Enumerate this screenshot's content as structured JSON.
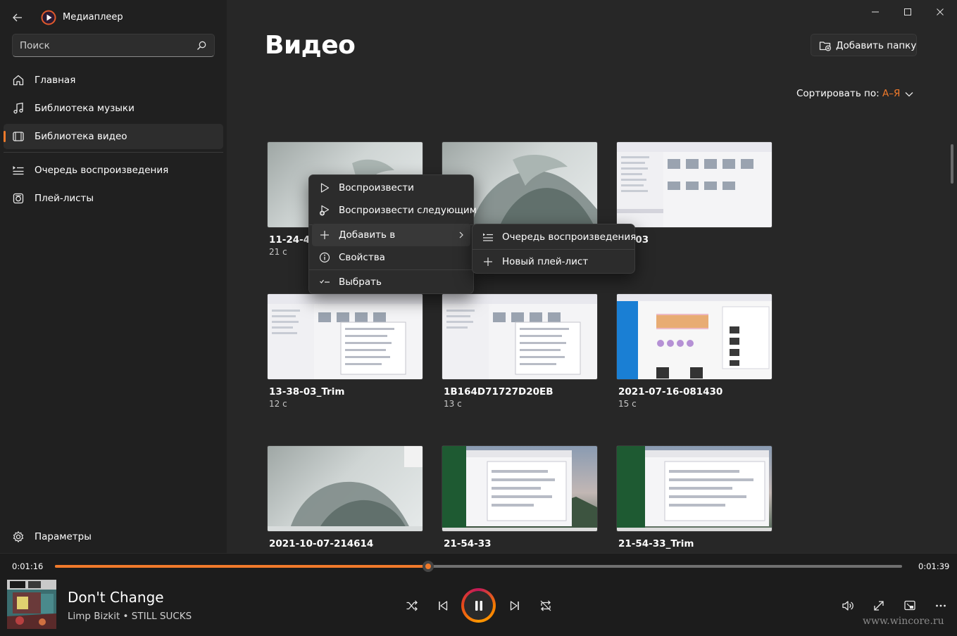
{
  "app": {
    "title": "Медиаплеер"
  },
  "search": {
    "placeholder": "Поиск"
  },
  "nav": {
    "home": "Главная",
    "music": "Библиотека музыки",
    "video": "Библиотека видео",
    "queue": "Очередь воспроизведения",
    "playlists": "Плей-листы",
    "settings": "Параметры"
  },
  "main": {
    "title": "Видео",
    "add_folder": "Добавить папку",
    "sort_label": "Сортировать по: ",
    "sort_value": "А–Я"
  },
  "videos": [
    {
      "title": "11-24-47",
      "duration": "21 с"
    },
    {
      "title": "",
      "duration": ""
    },
    {
      "title": "38-03",
      "duration": ""
    },
    {
      "title": "13-38-03_Trim",
      "duration": "12 с"
    },
    {
      "title": "1B164D71727D20EB",
      "duration": "13 с"
    },
    {
      "title": "2021-07-16-081430",
      "duration": "15 с"
    },
    {
      "title": "2021-10-07-214614",
      "duration": ""
    },
    {
      "title": "21-54-33",
      "duration": ""
    },
    {
      "title": "21-54-33_Trim",
      "duration": ""
    }
  ],
  "context_menu": {
    "play": "Воспроизвести",
    "play_next": "Воспроизвести следующим",
    "add_to": "Добавить в",
    "properties": "Свойства",
    "select": "Выбрать"
  },
  "submenu": {
    "queue": "Очередь воспроизведения",
    "new_playlist": "Новый плей-лист"
  },
  "player": {
    "elapsed": "0:01:16",
    "total": "0:01:39",
    "progress_fraction": 0.4405,
    "song": "Don't Change",
    "artist_album": "Limp Bizkit • STILL SUCKS"
  },
  "watermark": "www.wincore.ru",
  "colors": {
    "accent": "#f07a2b",
    "background": "#202020",
    "main_bg": "#272727"
  }
}
